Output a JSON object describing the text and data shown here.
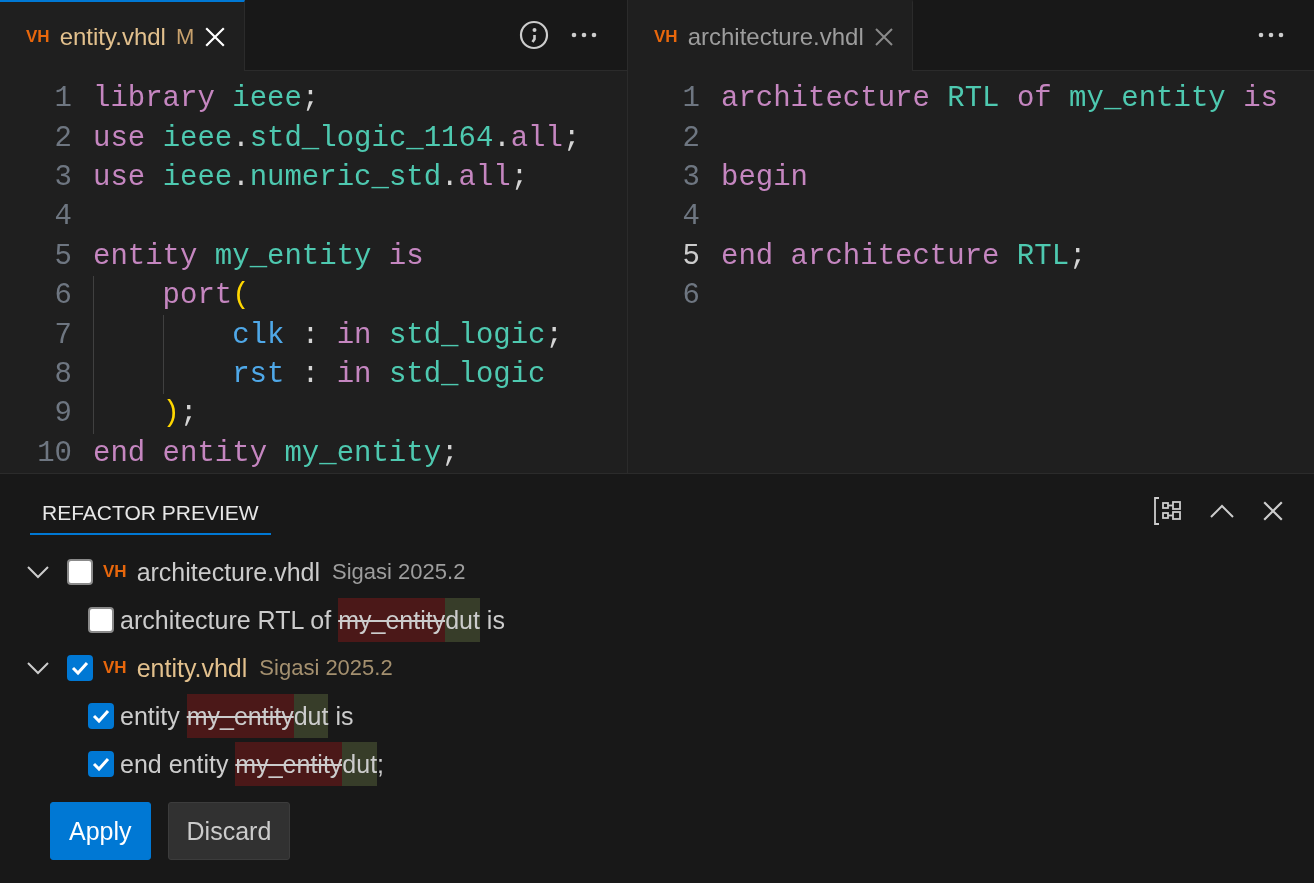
{
  "editors": [
    {
      "focused": true,
      "tab": {
        "badge": "VH",
        "label": "entity.vhdl",
        "status": "M",
        "modified": true
      },
      "actions": [
        {
          "kind": "inlay"
        },
        {
          "kind": "more"
        }
      ],
      "lines": [
        {
          "number": "1",
          "tokens": [
            {
              "text": "library ",
              "kind": "keyword"
            },
            {
              "text": "ieee",
              "kind": "name"
            },
            {
              "text": ";",
              "kind": "punct"
            }
          ]
        },
        {
          "number": "2",
          "tokens": [
            {
              "text": "use ",
              "kind": "keyword"
            },
            {
              "text": "ieee",
              "kind": "name"
            },
            {
              "text": ".",
              "kind": "punct"
            },
            {
              "text": "std_logic_1164",
              "kind": "name"
            },
            {
              "text": ".",
              "kind": "punct"
            },
            {
              "text": "all",
              "kind": "keyword"
            },
            {
              "text": ";",
              "kind": "punct"
            }
          ]
        },
        {
          "number": "3",
          "tokens": [
            {
              "text": "use ",
              "kind": "keyword"
            },
            {
              "text": "ieee",
              "kind": "name"
            },
            {
              "text": ".",
              "kind": "punct"
            },
            {
              "text": "numeric_std",
              "kind": "name"
            },
            {
              "text": ".",
              "kind": "punct"
            },
            {
              "text": "all",
              "kind": "keyword"
            },
            {
              "text": ";",
              "kind": "punct"
            }
          ]
        },
        {
          "number": "4"
        },
        {
          "number": "5",
          "tokens": [
            {
              "text": "entity ",
              "kind": "keyword"
            },
            {
              "text": "my_entity ",
              "kind": "name"
            },
            {
              "text": "is",
              "kind": "keyword"
            }
          ],
          "children": [
            {
              "number": "6",
              "tokens": [
                {
                  "text": "port",
                  "kind": "keyword"
                },
                {
                  "text": "(",
                  "kind": "paren"
                }
              ],
              "children": [
                {
                  "number": "7",
                  "tokens": [
                    {
                      "text": "clk ",
                      "kind": "port"
                    },
                    {
                      "text": ": ",
                      "kind": "punct"
                    },
                    {
                      "text": "in ",
                      "kind": "keyword"
                    },
                    {
                      "text": "std_logic",
                      "kind": "name"
                    },
                    {
                      "text": ";",
                      "kind": "punct"
                    }
                  ]
                },
                {
                  "number": "8",
                  "tokens": [
                    {
                      "text": "rst ",
                      "kind": "port"
                    },
                    {
                      "text": ": ",
                      "kind": "punct"
                    },
                    {
                      "text": "in ",
                      "kind": "keyword"
                    },
                    {
                      "text": "std_logic",
                      "kind": "name"
                    }
                  ]
                }
              ]
            },
            {
              "number": "9",
              "tokens": [
                {
                  "text": ")",
                  "kind": "paren"
                },
                {
                  "text": ";",
                  "kind": "punct"
                }
              ]
            }
          ]
        },
        {
          "number": "10",
          "tokens": [
            {
              "text": "end entity ",
              "kind": "keyword"
            },
            {
              "text": "my_entity",
              "kind": "name"
            },
            {
              "text": ";",
              "kind": "punct"
            }
          ]
        }
      ]
    },
    {
      "focused": false,
      "tab": {
        "badge": "VH",
        "label": "architecture.vhdl",
        "modified": false
      },
      "actions": [
        {
          "kind": "more"
        }
      ],
      "lines": [
        {
          "number": "1",
          "active": false,
          "tokens": [
            {
              "text": "architecture ",
              "kind": "keyword"
            },
            {
              "text": "RTL ",
              "kind": "name"
            },
            {
              "text": "of ",
              "kind": "keyword"
            },
            {
              "text": "my_entity ",
              "kind": "name"
            },
            {
              "text": "is",
              "kind": "keyword"
            }
          ]
        },
        {
          "number": "2",
          "active": false
        },
        {
          "number": "3",
          "active": false,
          "tokens": [
            {
              "text": "begin",
              "kind": "keyword"
            }
          ]
        },
        {
          "number": "4",
          "active": false
        },
        {
          "number": "5",
          "active": true,
          "tokens": [
            {
              "text": "end architecture ",
              "kind": "keyword"
            },
            {
              "text": "RTL",
              "kind": "name"
            },
            {
              "text": ";",
              "kind": "punct"
            }
          ]
        },
        {
          "number": "6",
          "active": false
        }
      ]
    }
  ],
  "panel": {
    "title": "REFACTOR PREVIEW",
    "actions": [
      {
        "kind": "group"
      },
      {
        "kind": "collapse"
      },
      {
        "kind": "close"
      }
    ],
    "files": [
      {
        "badge": "VH",
        "name": "architecture.vhdl",
        "description": "Sigasi 2025.2",
        "modified": false,
        "expanded": true,
        "checked": false,
        "changes": [
          {
            "checked": false,
            "segments": [
              {
                "text": "architecture RTL of ",
                "kind": "plain"
              },
              {
                "text": "my_entity",
                "kind": "removed"
              },
              {
                "text": "dut",
                "kind": "added"
              },
              {
                "text": " is",
                "kind": "plain"
              }
            ]
          }
        ]
      },
      {
        "badge": "VH",
        "name": "entity.vhdl",
        "description": "Sigasi 2025.2",
        "modified": true,
        "expanded": true,
        "checked": true,
        "changes": [
          {
            "checked": true,
            "segments": [
              {
                "text": "entity ",
                "kind": "plain"
              },
              {
                "text": "my_entity",
                "kind": "removed"
              },
              {
                "text": "dut",
                "kind": "added"
              },
              {
                "text": " is",
                "kind": "plain"
              }
            ]
          },
          {
            "checked": true,
            "segments": [
              {
                "text": "end entity ",
                "kind": "plain"
              },
              {
                "text": "my_entity",
                "kind": "removed"
              },
              {
                "text": "dut",
                "kind": "added"
              },
              {
                "text": ";",
                "kind": "plain"
              }
            ]
          }
        ]
      }
    ],
    "buttons": [
      {
        "label": "Apply",
        "kind": "primary"
      },
      {
        "label": "Discard",
        "kind": "secondary"
      }
    ]
  }
}
